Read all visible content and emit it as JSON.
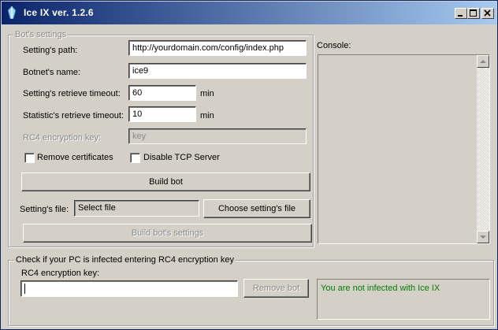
{
  "window": {
    "title": "Ice IX ver. 1.2.6"
  },
  "bots_settings": {
    "legend": "Bot's settings",
    "settings_path_label": "Setting's path:",
    "settings_path_value": "http://yourdomain.com/config/index.php",
    "botnet_name_label": "Botnet's name:",
    "botnet_name_value": "ice9",
    "settings_timeout_label": "Setting's retrieve timeout:",
    "settings_timeout_value": "60",
    "settings_timeout_unit": "min",
    "statistic_timeout_label": "Statistic's retrieve timeout:",
    "statistic_timeout_value": "10",
    "statistic_timeout_unit": "min",
    "rc4_key_label": "RC4 encryption key:",
    "rc4_key_value": "key",
    "remove_certificates_label": "Remove certificates",
    "disable_tcp_label": "Disable TCP Server",
    "build_bot_label": "Build bot",
    "settings_file_label": "Setting's file:",
    "settings_file_value": "Select file",
    "choose_file_label": "Choose setting's file",
    "build_settings_label": "Build bot's settings"
  },
  "console": {
    "label": "Console:"
  },
  "infection_check": {
    "legend": "Check if your PC is infected entering RC4 encryption key",
    "rc4_key_label": "RC4 encryption key:",
    "rc4_key_value": "",
    "remove_bot_label": "Remove bot",
    "status_text": "You are not infected with Ice IX",
    "status_color": "#008000"
  },
  "icons": [
    "app-crystal-icon",
    "minimize-icon",
    "maximize-icon",
    "close-icon",
    "scroll-up-icon",
    "scroll-down-icon"
  ]
}
